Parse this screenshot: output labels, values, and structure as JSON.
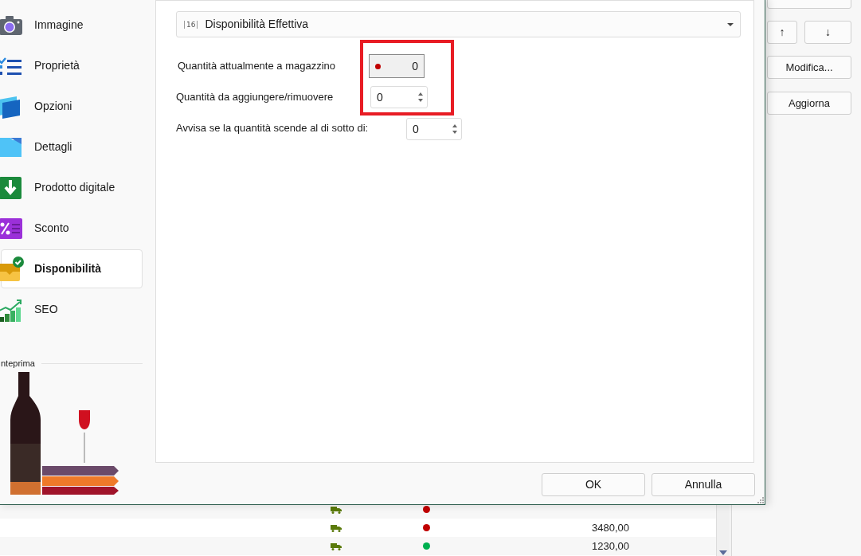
{
  "background_panel": {
    "buttons": [
      {
        "kind": "cut"
      },
      {
        "label": "↑",
        "kind": "arrow"
      },
      {
        "label": "↓",
        "kind": "arrow"
      },
      {
        "label": "Modifica...",
        "kind": "text"
      },
      {
        "label": "Aggiorna",
        "kind": "text"
      }
    ]
  },
  "background_table": {
    "rows": [
      {
        "color": "#c00000"
      },
      {
        "color": "#c00000",
        "amount": "3480,00"
      },
      {
        "color": "#00b050",
        "amount": "1230,00"
      }
    ]
  },
  "dialog": {
    "sidebar": {
      "items": [
        {
          "label": "Immagine",
          "selected": false
        },
        {
          "label": "Proprietà",
          "selected": false
        },
        {
          "label": "Opzioni",
          "selected": false
        },
        {
          "label": "Dettagli",
          "selected": false
        },
        {
          "label": "Prodotto digitale",
          "selected": false
        },
        {
          "label": "Sconto",
          "selected": false
        },
        {
          "label": "Disponibilità",
          "selected": true
        },
        {
          "label": "SEO",
          "selected": false
        }
      ],
      "preview_label": "nteprima"
    },
    "mode_dropdown": {
      "icon_text": "16",
      "value": "Disponibilità Effettiva"
    },
    "fields": [
      {
        "kind": "readonly",
        "label": "Quantità attualmente a magazzino",
        "value": "0",
        "color": "#c00000"
      },
      {
        "kind": "spinner",
        "label": "Quantità da aggiungere/rimuovere",
        "value": "0"
      },
      {
        "kind": "spinner",
        "label": "Avvisa se la quantità scende al di sotto di:",
        "value": "0"
      }
    ],
    "buttons": [
      "OK",
      "Annulla"
    ]
  }
}
